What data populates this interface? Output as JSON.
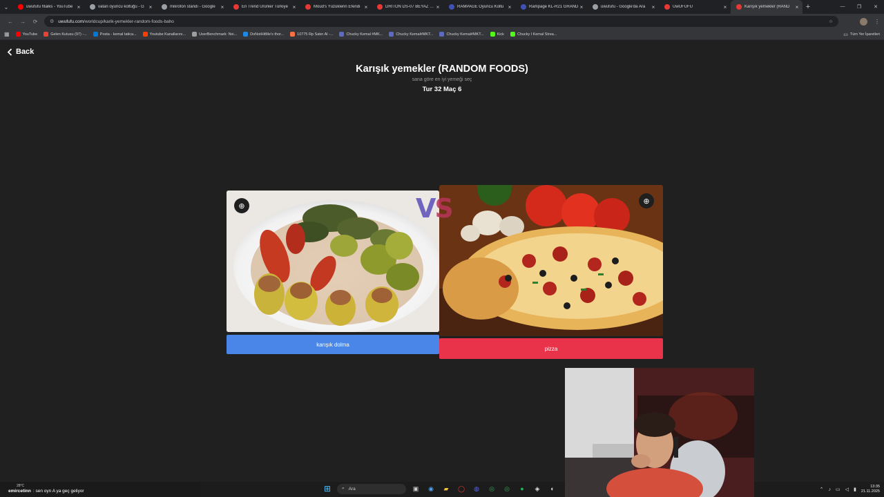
{
  "browser": {
    "tabs": [
      {
        "title": "uwufufu htalks - YouTube",
        "color": "#ff0000"
      },
      {
        "title": "vatan oyuncu koltuğu - G",
        "color": "#9aa0a6"
      },
      {
        "title": "mikrofon standı - Google",
        "color": "#9aa0a6"
      },
      {
        "title": "En Trend Ürünler Türkiye",
        "color": "#e53935"
      },
      {
        "title": "Moud's Yüzüklerin Efendi",
        "color": "#e53935"
      },
      {
        "title": "DRITON DS-07 BEYAZ PR",
        "color": "#e53935"
      },
      {
        "title": "RAMPAGE Oyuncu Koltu",
        "color": "#3f51b5"
      },
      {
        "title": "Rampage KL-R21 GRAND",
        "color": "#3f51b5"
      },
      {
        "title": "uwufufu - Google'da Ara",
        "color": "#9aa0a6"
      },
      {
        "title": "UwUFUFU",
        "color": "#e53935"
      },
      {
        "title": "Karışık yemekler (RAND",
        "color": "#e53935",
        "active": true
      }
    ],
    "new_tab_glyph": "+",
    "close_glyph": "×",
    "url_host": "uwufufu.com",
    "url_path": "/worldcup/karik-yemekler-random-foods-baho",
    "bookmarks": [
      {
        "label": "YouTube",
        "color": "#ff0000"
      },
      {
        "label": "Gelen Kutusu (97) -...",
        "color": "#ea4335"
      },
      {
        "label": "Posta - kemal tatica...",
        "color": "#0078d4"
      },
      {
        "label": "Youtube Kanallarını...",
        "color": "#ff3d00"
      },
      {
        "label": "UserBenchmark: Nvi...",
        "color": "#9e9e9e"
      },
      {
        "label": "DoNotHitMe's thor...",
        "color": "#1e88e5"
      },
      {
        "label": "10775 Rp Satın Al -...",
        "color": "#ff7043"
      },
      {
        "label": "Chucky Kemal #MK...",
        "color": "#5c6bc0"
      },
      {
        "label": "Chucky Kemal#MKT...",
        "color": "#5c6bc0"
      },
      {
        "label": "Chucky Kemal#MKT...",
        "color": "#5c6bc0"
      },
      {
        "label": "Kick",
        "color": "#53fc18"
      },
      {
        "label": "Chucky l Kemal Strea...",
        "color": "#53fc18"
      }
    ],
    "all_bookmarks": "Tüm Yer İşaretleri"
  },
  "page": {
    "back_label": "Back",
    "title": "Karışık yemekler (RANDOM FOODS)",
    "subtitle": "sana göre en iyi yemeği seç",
    "round": "Tur 32 Maç 6",
    "vs_v": "V",
    "vs_s": "S",
    "left": {
      "label": "karışık dolma",
      "color": "#4a86e8"
    },
    "right": {
      "label": "pizza",
      "color": "#e8334a"
    }
  },
  "taskbar": {
    "chat_user": "emircetinn",
    "chat_message": "sen oyn A ya geç geliyor",
    "weather": "28°C",
    "search_label": "Ara",
    "time": "13:35",
    "date": "21.11.2025"
  }
}
